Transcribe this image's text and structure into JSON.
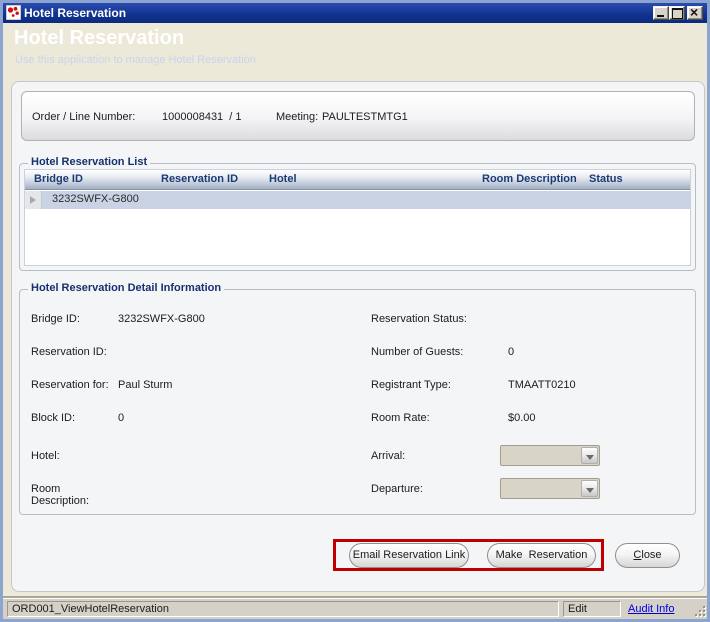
{
  "colors": {
    "titlebar_navy": "#0c2c86",
    "header_blue": "#4a74c4",
    "legend_navy": "#17316e",
    "selected_row_blue": "#c9d3e4",
    "annotation_red": "#c00000",
    "link_blue": "#0000e0",
    "statusbar_gray": "#d5d1c7"
  },
  "window": {
    "title": "Hotel Reservation"
  },
  "banner": {
    "title": "Hotel Reservation",
    "subtitle": "Use this application to manage Hotel Reservation"
  },
  "order_bar": {
    "order_label": "Order / Line Number:",
    "order_value": "1000008431  / 1",
    "meeting_label": "Meeting:",
    "meeting_value": "PAULTESTMTG1"
  },
  "reservation_list": {
    "title": "Hotel Reservation List",
    "columns": [
      "Bridge ID",
      "Reservation ID",
      "Hotel",
      "Room Description",
      "Status"
    ],
    "rows": [
      {
        "bridge_id": "3232SWFX-G800",
        "reservation_id": "",
        "hotel": "",
        "room_description": "",
        "status": ""
      }
    ]
  },
  "detail": {
    "title": "Hotel Reservation Detail Information",
    "left": [
      {
        "label": "Bridge ID:",
        "value": "3232SWFX-G800"
      },
      {
        "label": "Reservation ID:",
        "value": ""
      },
      {
        "label": "Reservation for:",
        "value": "Paul Sturm"
      },
      {
        "label": "Block ID:",
        "value": "0"
      },
      {
        "label": "Hotel:",
        "value": ""
      },
      {
        "label": "Room Description:",
        "value": ""
      }
    ],
    "right": [
      {
        "label": "Reservation Status:",
        "value": ""
      },
      {
        "label": "Number of Guests:",
        "value": "0"
      },
      {
        "label": "Registrant Type:",
        "value": "TMAATT0210"
      },
      {
        "label": "Room Rate:",
        "value": "$0.00"
      },
      {
        "label": "Arrival:",
        "value": ""
      },
      {
        "label": "Departure:",
        "value": ""
      }
    ]
  },
  "buttons": {
    "email": "Email Reservation Link",
    "make": "Make  Reservation",
    "close_underlined": "C",
    "close_rest": "lose"
  },
  "status_bar": {
    "context": "ORD001_ViewHotelReservation",
    "mode": "Edit",
    "audit_link": "Audit Info"
  }
}
